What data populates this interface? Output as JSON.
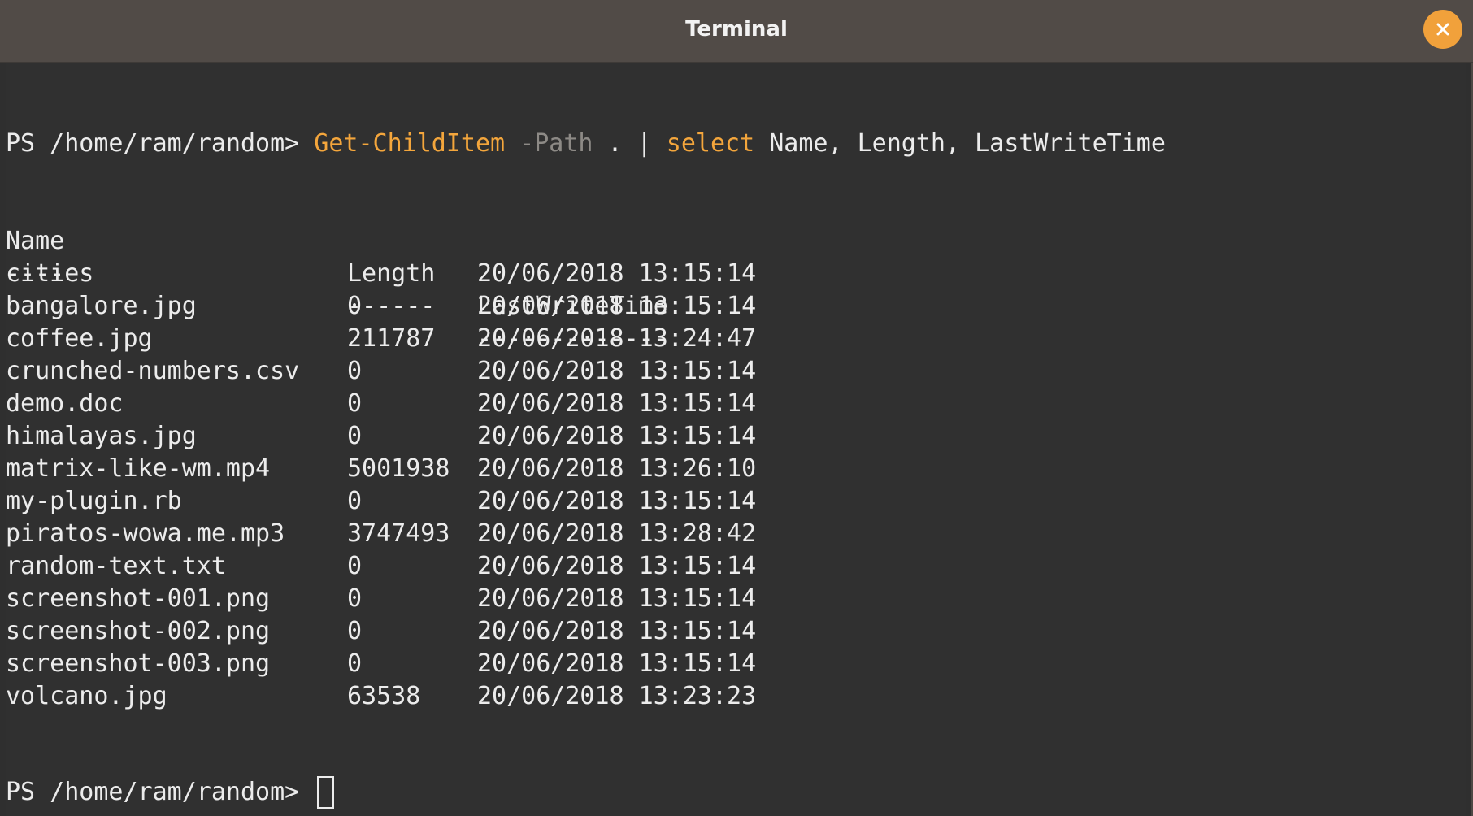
{
  "window": {
    "title": "Terminal"
  },
  "colors": {
    "accent": "#f1a13b",
    "command": "#f4a63c",
    "parameter": "#8d8a86",
    "text": "#ececec",
    "background": "#303030"
  },
  "prompt": "PS /home/ram/random>",
  "command": {
    "cmdlet": "Get-ChildItem",
    "parameter": "-Path",
    "argument": ".",
    "pipe": "|",
    "select_cmd": "select",
    "select_args": "Name, Length, LastWriteTime"
  },
  "table": {
    "headers": {
      "name": "Name",
      "length": "Length",
      "time": "LastWriteTime"
    },
    "separators": {
      "name": "----",
      "length": "------",
      "time": "-------------"
    },
    "rows": [
      {
        "name": "cities",
        "length": "",
        "time": "20/06/2018 13:15:14"
      },
      {
        "name": "bangalore.jpg",
        "length": "0",
        "time": "20/06/2018 13:15:14"
      },
      {
        "name": "coffee.jpg",
        "length": "211787",
        "time": "20/06/2018 13:24:47"
      },
      {
        "name": "crunched-numbers.csv",
        "length": "0",
        "time": "20/06/2018 13:15:14"
      },
      {
        "name": "demo.doc",
        "length": "0",
        "time": "20/06/2018 13:15:14"
      },
      {
        "name": "himalayas.jpg",
        "length": "0",
        "time": "20/06/2018 13:15:14"
      },
      {
        "name": "matrix-like-wm.mp4",
        "length": "5001938",
        "time": "20/06/2018 13:26:10"
      },
      {
        "name": "my-plugin.rb",
        "length": "0",
        "time": "20/06/2018 13:15:14"
      },
      {
        "name": "piratos-wowa.me.mp3",
        "length": "3747493",
        "time": "20/06/2018 13:28:42"
      },
      {
        "name": "random-text.txt",
        "length": "0",
        "time": "20/06/2018 13:15:14"
      },
      {
        "name": "screenshot-001.png",
        "length": "0",
        "time": "20/06/2018 13:15:14"
      },
      {
        "name": "screenshot-002.png",
        "length": "0",
        "time": "20/06/2018 13:15:14"
      },
      {
        "name": "screenshot-003.png",
        "length": "0",
        "time": "20/06/2018 13:15:14"
      },
      {
        "name": "volcano.jpg",
        "length": "63538",
        "time": "20/06/2018 13:23:23"
      }
    ]
  }
}
